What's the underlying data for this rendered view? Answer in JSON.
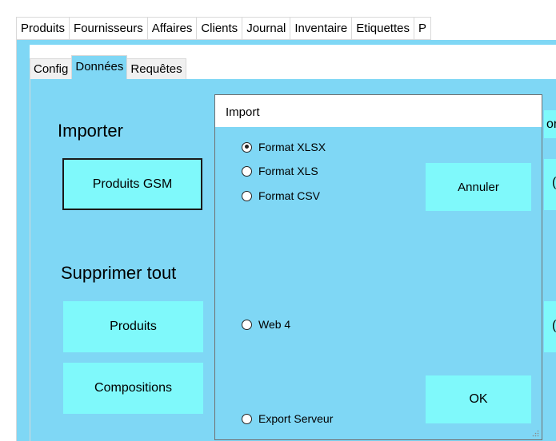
{
  "main_tabs": [
    "Produits",
    "Fournisseurs",
    "Affaires",
    "Clients",
    "Journal",
    "Inventaire",
    "Etiquettes",
    "P"
  ],
  "sub_tabs": [
    "Config",
    "Données",
    "Requêtes"
  ],
  "importer": {
    "title": "Importer",
    "button": "Produits GSM"
  },
  "supprimer": {
    "title": "Supprimer tout",
    "buttons": [
      "Produits",
      "Compositions"
    ]
  },
  "peek": {
    "right_top_text": "or",
    "right_mid_text": "(",
    "right_low_text": "("
  },
  "dialog": {
    "title": "Import",
    "options": [
      "Format XLSX",
      "Format XLS",
      "Format CSV",
      "Web 4",
      "Export Serveur"
    ],
    "selected": "Format XLSX",
    "cancel_label": "Annuler",
    "ok_label": "OK"
  },
  "colors": {
    "panel": "#7fd7f5",
    "button": "#7ff9fb"
  }
}
